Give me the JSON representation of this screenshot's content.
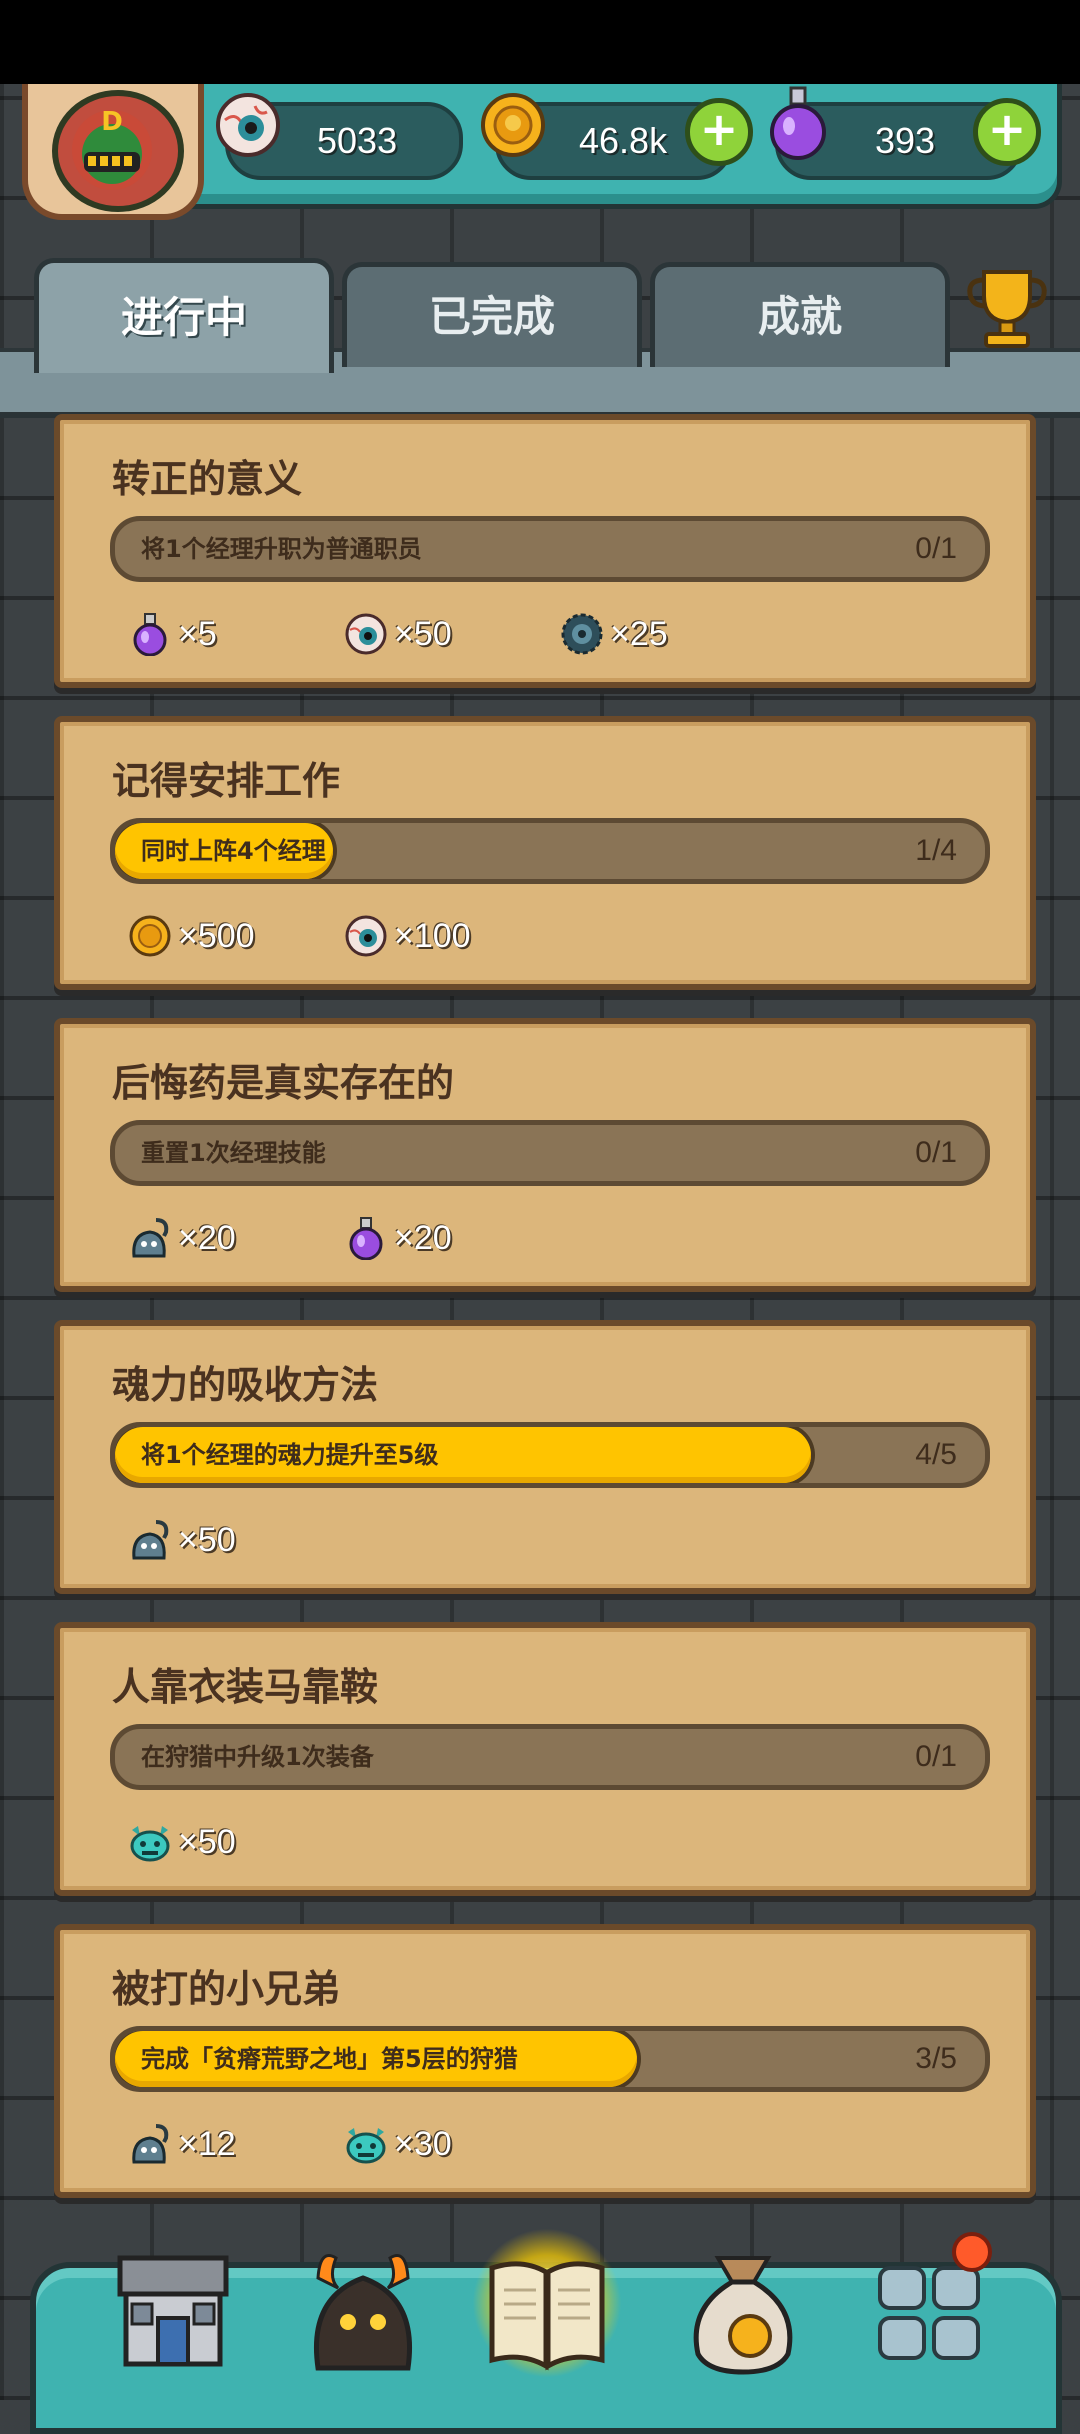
{
  "resources": {
    "eyeball": {
      "value": "5033",
      "icon": "eyeball-icon"
    },
    "coins": {
      "value": "46.8k",
      "icon": "gold-coin-icon"
    },
    "potion": {
      "value": "393",
      "icon": "purple-potion-icon"
    }
  },
  "tabs": [
    {
      "label": "进行中",
      "active": true
    },
    {
      "label": "已完成",
      "active": false
    },
    {
      "label": "成就",
      "active": false
    }
  ],
  "quests": [
    {
      "title": "转正的意义",
      "desc": "将1个经理升职为普通职员",
      "count": "0/1",
      "progress": 0.0,
      "rewards": [
        {
          "icon": "purple-potion-icon",
          "amount": "×5"
        },
        {
          "icon": "eyeball-icon",
          "amount": "×50"
        },
        {
          "icon": "gear-icon",
          "amount": "×25"
        }
      ]
    },
    {
      "title": "记得安排工作",
      "desc": "同时上阵4个经理",
      "count": "1/4",
      "progress": 0.25,
      "rewards": [
        {
          "icon": "gold-coin-icon",
          "amount": "×500"
        },
        {
          "icon": "eyeball-icon",
          "amount": "×100"
        }
      ]
    },
    {
      "title": "后悔药是真实存在的",
      "desc": "重置1次经理技能",
      "count": "0/1",
      "progress": 0.0,
      "rewards": [
        {
          "icon": "ghost-lantern-icon",
          "amount": "×20"
        },
        {
          "icon": "purple-potion-icon",
          "amount": "×20"
        }
      ]
    },
    {
      "title": "魂力的吸收方法",
      "desc": "将1个经理的魂力提升至5级",
      "count": "4/5",
      "progress": 0.8,
      "rewards": [
        {
          "icon": "ghost-lantern-icon",
          "amount": "×50"
        }
      ]
    },
    {
      "title": "人靠衣装马靠鞍",
      "desc": "在狩猎中升级1次装备",
      "count": "0/1",
      "progress": 0.0,
      "rewards": [
        {
          "icon": "teal-monster-icon",
          "amount": "×50"
        }
      ]
    },
    {
      "title": "被打的小兄弟",
      "desc": "完成「贫瘠荒野之地」第5层的狩猎",
      "count": "3/5",
      "progress": 0.6,
      "rewards": [
        {
          "icon": "ghost-lantern-icon",
          "amount": "×12"
        },
        {
          "icon": "teal-monster-icon",
          "amount": "×30"
        }
      ]
    }
  ],
  "bottom_nav": [
    {
      "icon": "shop-building-icon",
      "active": false
    },
    {
      "icon": "fire-monster-icon",
      "active": false
    },
    {
      "icon": "open-book-icon",
      "active": true
    },
    {
      "icon": "money-bag-icon",
      "active": false
    },
    {
      "icon": "menu-grid-icon",
      "active": false,
      "badge": true
    }
  ],
  "colors": {
    "accent_teal": "#3fb3b0",
    "progress_yellow": "#ffc400",
    "card_parchment": "#dcb67b",
    "badge_red": "#ff5a2a"
  }
}
